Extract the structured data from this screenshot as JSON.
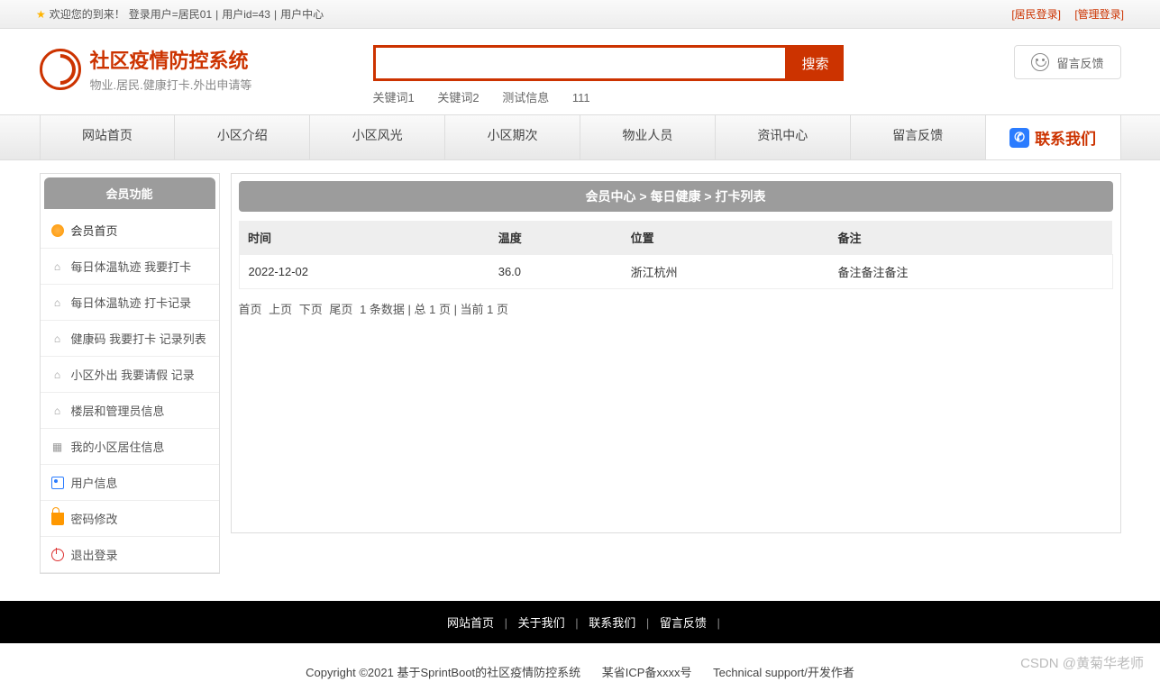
{
  "topbar": {
    "welcome_prefix": "欢迎您的到来！",
    "login_user_label": "登录用户=居民01",
    "user_id_label": "用户id=43",
    "user_center": "用户中心",
    "resident_login": "[居民登录]",
    "admin_login": "[管理登录]"
  },
  "brand": {
    "title": "社区疫情防控系统",
    "subtitle": "物业.居民.健康打卡.外出申请等"
  },
  "search": {
    "button": "搜索",
    "value": "",
    "keywords": [
      "关键词1",
      "关键词2",
      "测试信息",
      "111"
    ]
  },
  "header_feedback": "留言反馈",
  "nav": {
    "items": [
      "网站首页",
      "小区介绍",
      "小区风光",
      "小区期次",
      "物业人员",
      "资讯中心",
      "留言反馈"
    ],
    "contact": "联系我们"
  },
  "sidebar": {
    "title": "会员功能",
    "items": [
      {
        "label": "会员首页",
        "ico": "circle"
      },
      {
        "label": "每日体温轨迹 我要打卡",
        "ico": "home"
      },
      {
        "label": "每日体温轨迹 打卡记录",
        "ico": "home"
      },
      {
        "label": "健康码 我要打卡 记录列表",
        "ico": "home"
      },
      {
        "label": "小区外出 我要请假 记录",
        "ico": "home"
      },
      {
        "label": "楼层和管理员信息",
        "ico": "home"
      },
      {
        "label": "我的小区居住信息",
        "ico": "grid"
      },
      {
        "label": "用户信息",
        "ico": "card"
      },
      {
        "label": "密码修改",
        "ico": "lock"
      },
      {
        "label": "退出登录",
        "ico": "power"
      }
    ]
  },
  "breadcrumb": "会员中心 > 每日健康 > 打卡列表",
  "table": {
    "headers": [
      "时间",
      "温度",
      "位置",
      "备注"
    ],
    "rows": [
      {
        "time": "2022-12-02",
        "temp": "36.0",
        "loc": "浙江杭州",
        "note": "备注备注备注"
      }
    ]
  },
  "pager": {
    "first": "首页",
    "prev": "上页",
    "next": "下页",
    "last": "尾页",
    "summary": "1 条数据 | 总 1 页 | 当前 1 页"
  },
  "footer": {
    "links": [
      "网站首页",
      "关于我们",
      "联系我们",
      "留言反馈"
    ],
    "copyright": "Copyright ©2021 基于SprintBoot的社区疫情防控系统",
    "icp": "某省ICP备xxxx号",
    "tech": "Technical support/开发作者"
  },
  "watermark": "CSDN @黄菊华老师"
}
